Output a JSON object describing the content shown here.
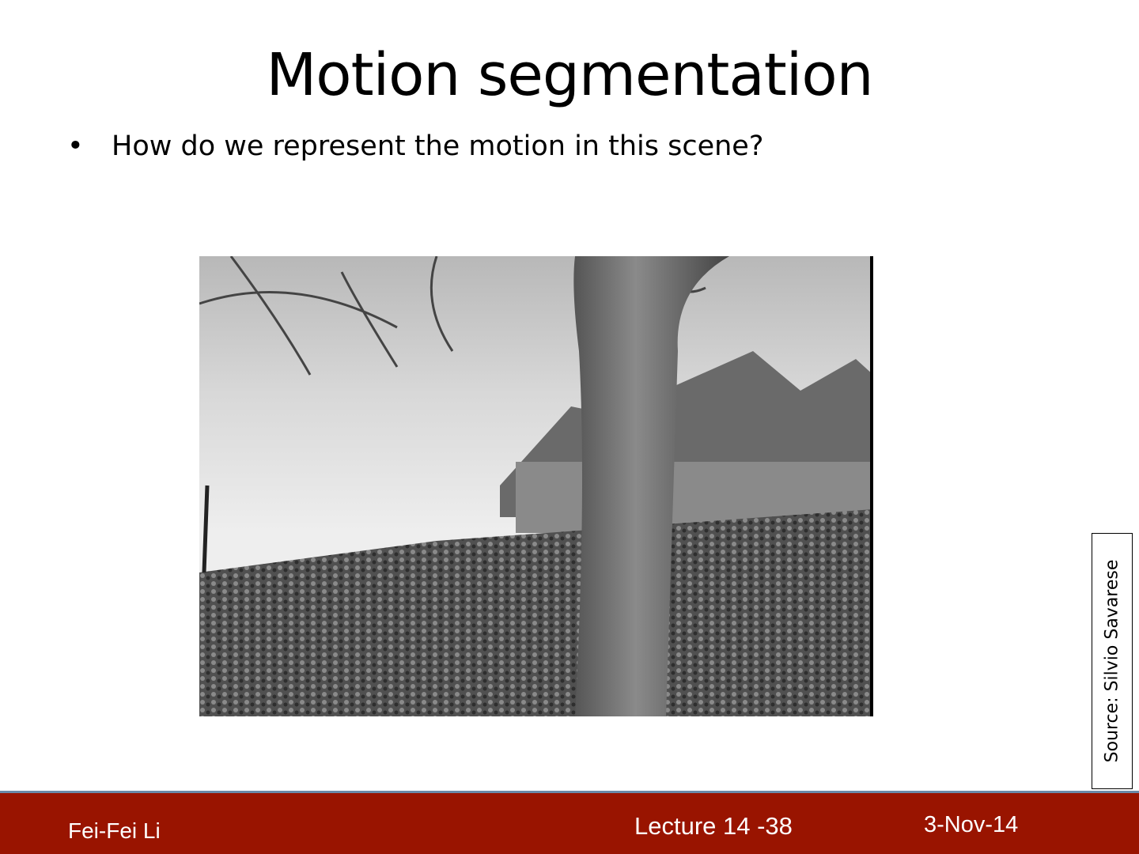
{
  "slide": {
    "title": "Motion segmentation",
    "bullets": [
      {
        "marker": "•",
        "text": "How do we represent the motion in this scene?"
      }
    ],
    "source_note": "Source: Silvio Savarese"
  },
  "footer": {
    "author": "Fei-Fei Li",
    "lecture": "Lecture 14 -38",
    "date": "3-Nov-14"
  },
  "colors": {
    "footer_bg": "#991400",
    "footer_border": "#6b8aa8"
  }
}
